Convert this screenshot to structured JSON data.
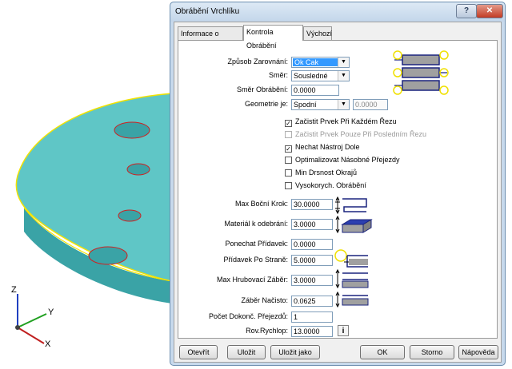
{
  "dialog": {
    "title": "Obrábění Vrchlíku",
    "title_buttons": {
      "help": "?",
      "close": "✕"
    }
  },
  "tabs": [
    {
      "label": "Informace o Nástroji"
    },
    {
      "label": "Kontrola Obrábění",
      "active": true
    },
    {
      "label": "Výchozí"
    }
  ],
  "form": {
    "zpusob_zarovnani": {
      "label": "Způsob Zarovnání:",
      "value": "Ok Cak"
    },
    "smer": {
      "label": "Směr:",
      "value": "Sousledné"
    },
    "smer_obrabeni": {
      "label": "Směr Obrábění:",
      "value": "0.0000"
    },
    "geometrie": {
      "label": "Geometrie je:",
      "value": "Spodní",
      "offset_value": "0.0000"
    },
    "checkboxes": [
      {
        "label": "Začistit Prvek Při Každém Řezu",
        "checked": true,
        "enabled": true
      },
      {
        "label": "Začistit Prvek Pouze Při Posledním Řezu",
        "checked": false,
        "enabled": false
      },
      {
        "label": "Nechat Nástroj Dole",
        "checked": true,
        "enabled": true
      },
      {
        "label": "Optimalizovat Násobné Přejezdy",
        "checked": false,
        "enabled": true
      },
      {
        "label": "Min Drsnost Okrajů",
        "checked": false,
        "enabled": true
      },
      {
        "label": "Vysokorych. Obrábění",
        "checked": false,
        "enabled": true
      }
    ],
    "check_mark": "✓",
    "max_bocni_krok": {
      "label": "Max Boční Krok:",
      "value": "30.0000"
    },
    "material_k_odebrani": {
      "label": "Materiál k odebrání:",
      "value": "3.0000"
    },
    "ponechat_pridavek": {
      "label": "Ponechat Přídavek:",
      "value": "0.0000"
    },
    "pridavek_po_strane": {
      "label": "Přídavek Po Straně:",
      "value": "5.0000"
    },
    "max_hrubovaci_zaber": {
      "label": "Max Hrubovací Záběr:",
      "value": "3.0000"
    },
    "zaber_nacisto": {
      "label": "Záběr Načisto:",
      "value": "0.0625"
    },
    "pocet_dokonc_prejezdu": {
      "label": "Počet Dokonč. Přejezdů:",
      "value": "1"
    },
    "rov_rychlop": {
      "label": "Rov.Rychlop:",
      "value": "13.0000"
    },
    "info_glyph": "i"
  },
  "buttons": {
    "otevrit": "Otevřít",
    "ulozit": "Uložit",
    "ulozit_jako": "Uložit jako",
    "ok": "OK",
    "storno": "Storno",
    "napoveda": "Nápověda"
  },
  "axes": {
    "z": "Z",
    "y": "Y",
    "x": "X"
  },
  "colors": {
    "part_face": "#5fc6c6",
    "part_edge": "#f2e200",
    "hole_outline": "#d02020",
    "dialog_frame": "#c7d9ec",
    "selection": "#3399ff",
    "preview_stroke": "#1a237e",
    "preview_fill": "#a0a0a0",
    "preview_highlight": "#f0e000"
  }
}
